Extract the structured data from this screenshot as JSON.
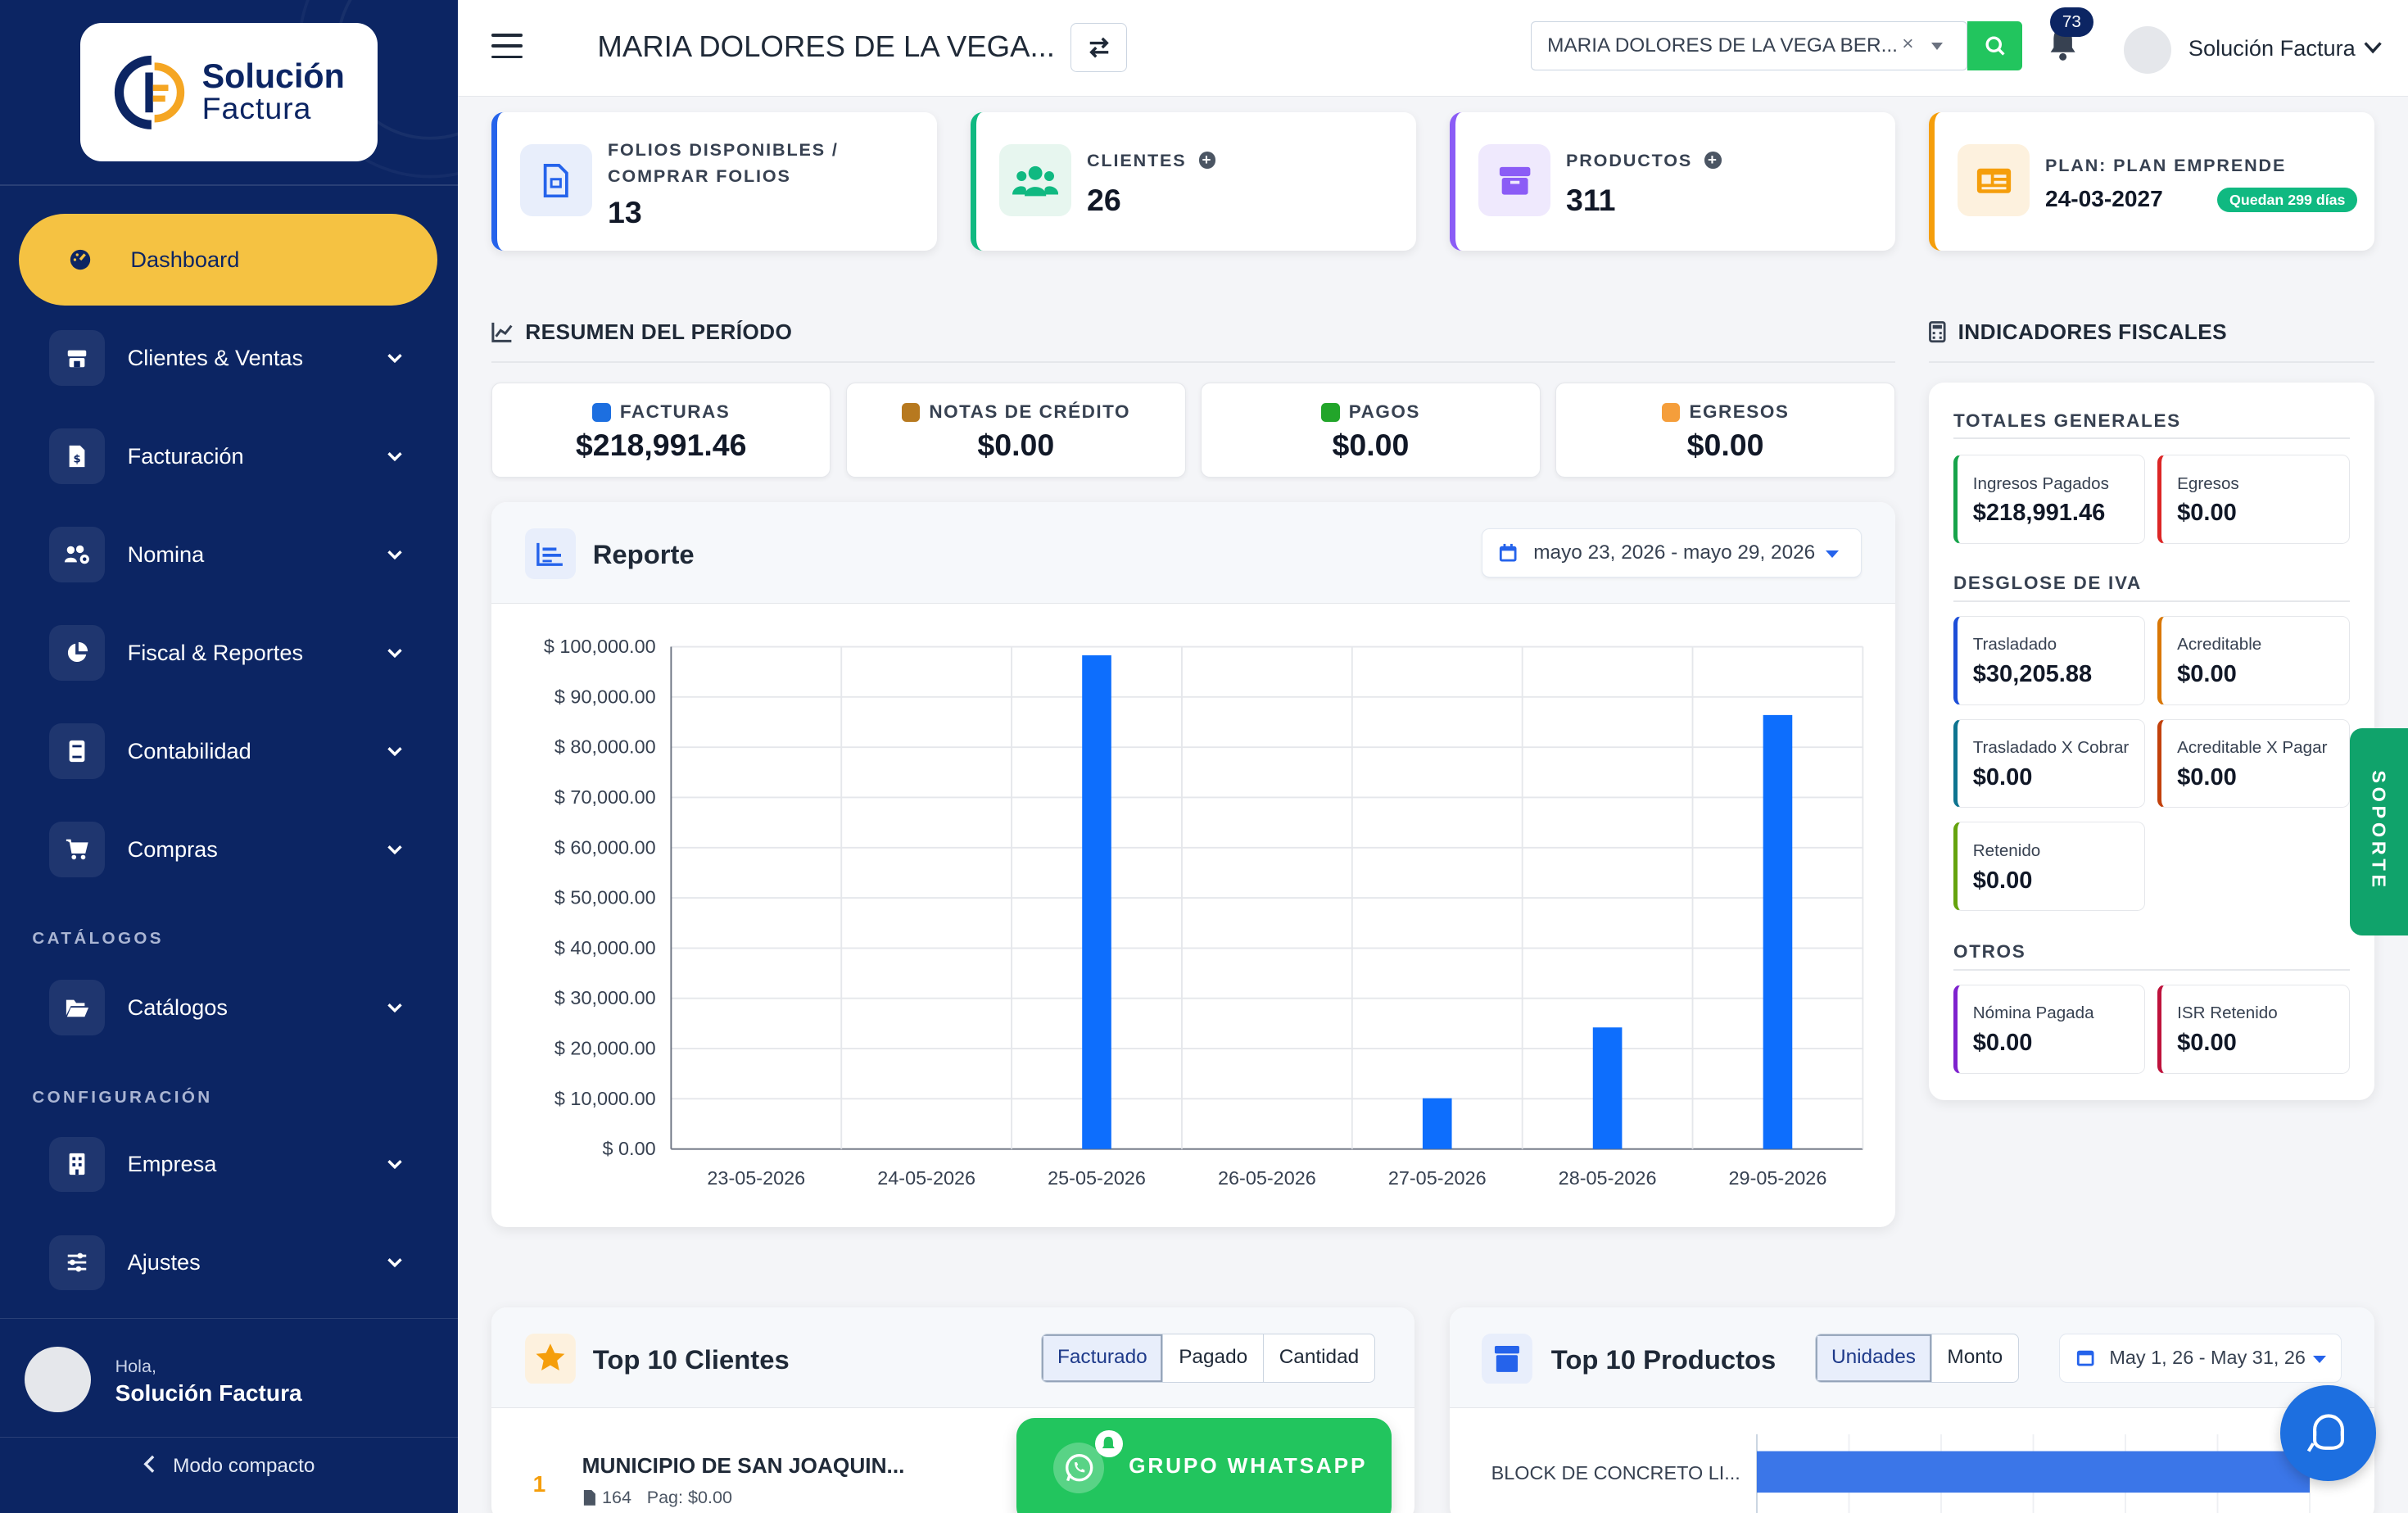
{
  "brand": {
    "line1": "Solución",
    "line2": "Factura"
  },
  "sidebar": {
    "items": [
      {
        "label": "Dashboard"
      },
      {
        "label": "Clientes & Ventas"
      },
      {
        "label": "Facturación"
      },
      {
        "label": "Nomina"
      },
      {
        "label": "Fiscal & Reportes"
      },
      {
        "label": "Contabilidad"
      },
      {
        "label": "Compras"
      },
      {
        "label": "Catálogos"
      },
      {
        "label": "Empresa"
      },
      {
        "label": "Ajustes"
      }
    ],
    "sections": {
      "catalogos": "CATÁLOGOS",
      "configuracion": "CONFIGURACIÓN"
    },
    "user": {
      "greeting": "Hola,",
      "name": "Solución Factura"
    },
    "compact_mode": "Modo compacto"
  },
  "header": {
    "title": "MARIA DOLORES DE LA VEGA...",
    "company_select": {
      "value": "MARIA DOLORES DE LA VEGA BER...",
      "clear": "×"
    },
    "notifications": "73",
    "user": "Solución Factura"
  },
  "stats": {
    "folios": {
      "label1": "FOLIOS DISPONIBLES /",
      "label2": "COMPRAR FOLIOS",
      "value": "13"
    },
    "clientes": {
      "label": "CLIENTES",
      "value": "26"
    },
    "productos": {
      "label": "PRODUCTOS",
      "value": "311"
    },
    "plan": {
      "label": "PLAN: PLAN EMPRENDE",
      "value": "24-03-2027",
      "badge": "Quedan 299 días"
    }
  },
  "summary": {
    "heading": "RESUMEN DEL PERÍODO",
    "items": [
      {
        "label": "FACTURAS",
        "value": "$218,991.46",
        "color": "#1d6fe0"
      },
      {
        "label": "NOTAS DE CRÉDITO",
        "value": "$0.00",
        "color": "#b7791f"
      },
      {
        "label": "PAGOS",
        "value": "$0.00",
        "color": "#22a52a"
      },
      {
        "label": "EGRESOS",
        "value": "$0.00",
        "color": "#f59e3b"
      }
    ]
  },
  "report": {
    "title": "Reporte",
    "date_range": "mayo 23, 2026 - mayo 29, 2026"
  },
  "chart_data": {
    "type": "bar",
    "categories": [
      "23-05-2026",
      "24-05-2026",
      "25-05-2026",
      "26-05-2026",
      "27-05-2026",
      "28-05-2026",
      "29-05-2026"
    ],
    "values": [
      0,
      0,
      98300,
      0,
      10100,
      24200,
      86400
    ],
    "ylim": [
      0,
      100000
    ],
    "ytick_labels": [
      "$ 0.00",
      "$ 10,000.00",
      "$ 20,000.00",
      "$ 30,000.00",
      "$ 40,000.00",
      "$ 50,000.00",
      "$ 60,000.00",
      "$ 70,000.00",
      "$ 80,000.00",
      "$ 90,000.00",
      "$ 100,000.00"
    ],
    "color": "#0d6efd",
    "grid": true
  },
  "fiscal": {
    "heading": "INDICADORES FISCALES",
    "totales": {
      "title": "TOTALES GENERALES",
      "items": [
        {
          "label": "Ingresos Pagados",
          "value": "$218,991.46",
          "color": "#16a34a"
        },
        {
          "label": "Egresos",
          "value": "$0.00",
          "color": "#dc2626"
        }
      ]
    },
    "iva": {
      "title": "DESGLOSE DE IVA",
      "items": [
        {
          "label": "Trasladado",
          "value": "$30,205.88",
          "color": "#1d4ed8"
        },
        {
          "label": "Acreditable",
          "value": "$0.00",
          "color": "#d97706"
        },
        {
          "label": "Trasladado X Cobrar",
          "value": "$0.00",
          "color": "#0e7490"
        },
        {
          "label": "Acreditable X Pagar",
          "value": "$0.00",
          "color": "#c2410c"
        },
        {
          "label": "Retenido",
          "value": "$0.00",
          "color": "#65a30d"
        }
      ]
    },
    "otros": {
      "title": "OTROS",
      "items": [
        {
          "label": "Nómina Pagada",
          "value": "$0.00",
          "color": "#7e22ce"
        },
        {
          "label": "ISR Retenido",
          "value": "$0.00",
          "color": "#be123c"
        }
      ]
    }
  },
  "soporte": "SOPORTE",
  "top_clientes": {
    "title": "Top 10 Clientes",
    "tabs": [
      "Facturado",
      "Pagado",
      "Cantidad"
    ],
    "rows": [
      {
        "rank": "1",
        "name": "MUNICIPIO DE SAN JOAQUIN...",
        "count": "164",
        "paid": "Pag: $0.00"
      }
    ]
  },
  "top_productos": {
    "title": "Top 10 Productos",
    "tabs": [
      "Unidades",
      "Monto"
    ],
    "date_range": "May 1, 26 - May 31, 26",
    "rows": [
      {
        "name": "BLOCK DE CONCRETO LI..."
      }
    ]
  },
  "whatsapp": {
    "label": "GRUPO WHATSAPP"
  }
}
